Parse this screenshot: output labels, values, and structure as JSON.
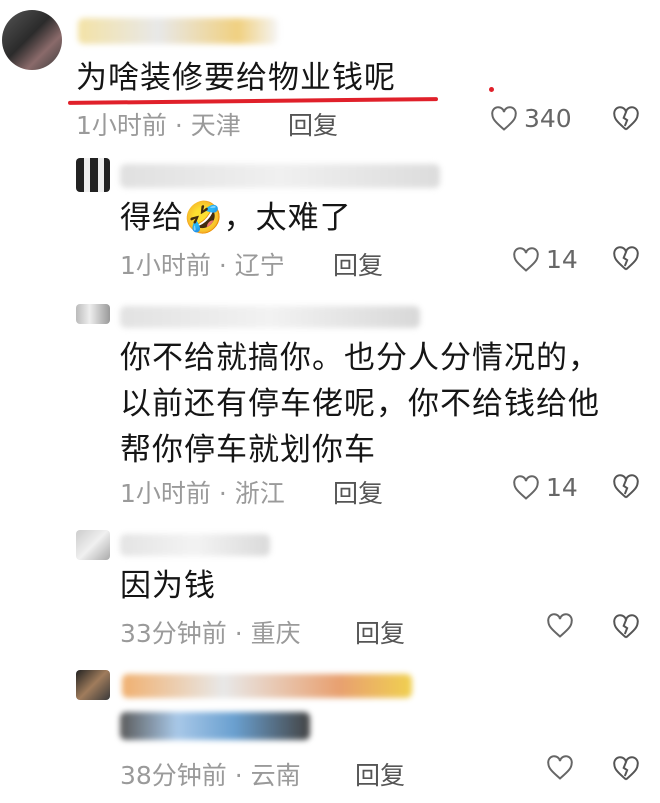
{
  "comments": [
    {
      "text": "为啥装修要给物业钱呢",
      "time": "1小时前",
      "location": "天津",
      "reply": "回复",
      "likes": "340"
    },
    {
      "text": "得给🤣，太难了",
      "time": "1小时前",
      "location": "辽宁",
      "reply": "回复",
      "likes": "14"
    },
    {
      "text_lines": [
        "你不给就搞你。也分人分情况的，",
        "以前还有停车佬呢，你不给钱给他",
        "帮你停车就划你车"
      ],
      "time": "1小时前",
      "location": "浙江",
      "reply": "回复",
      "likes": "14"
    },
    {
      "text": "因为钱",
      "time": "33分钟前",
      "location": "重庆",
      "reply": "回复",
      "likes": ""
    },
    {
      "text": "",
      "time": "38分钟前",
      "location": "云南",
      "reply": "回复",
      "likes": ""
    }
  ],
  "icons": {
    "like": "heart-outline-icon",
    "dislike": "broken-heart-icon"
  },
  "colors": {
    "highlight": "#e0202a",
    "meta": "#9a9a9a"
  }
}
